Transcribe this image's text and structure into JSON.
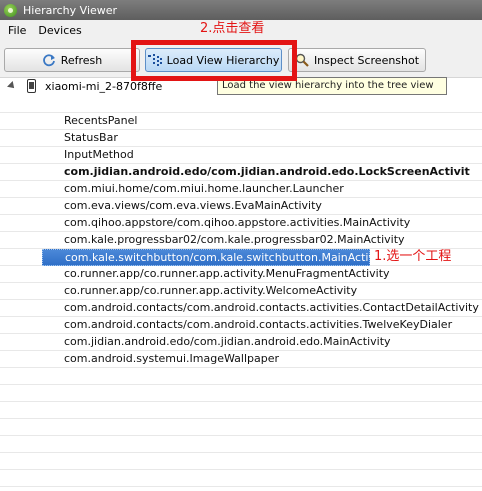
{
  "window": {
    "title": "Hierarchy Viewer"
  },
  "menu": {
    "items": [
      "File",
      "Devices"
    ]
  },
  "toolbar": {
    "refresh_label": "Refresh",
    "load_label": "Load View Hierarchy",
    "inspect_label": "Inspect Screenshot"
  },
  "tooltip": {
    "text": "Load the view hierarchy into the tree view"
  },
  "annotations": {
    "step2": "2.点击查看",
    "step1": "1.选一个工程",
    "color": "#e31414"
  },
  "device": {
    "name": "xiaomi-mi_2-870f8ffe"
  },
  "windows": [
    {
      "label": "RecentsPanel",
      "bold": false,
      "selected": false
    },
    {
      "label": "StatusBar",
      "bold": false,
      "selected": false
    },
    {
      "label": "InputMethod",
      "bold": false,
      "selected": false
    },
    {
      "label": "com.jidian.android.edo/com.jidian.android.edo.LockScreenActivit",
      "bold": true,
      "selected": false
    },
    {
      "label": "com.miui.home/com.miui.home.launcher.Launcher",
      "bold": false,
      "selected": false
    },
    {
      "label": "com.eva.views/com.eva.views.EvaMainActivity",
      "bold": false,
      "selected": false
    },
    {
      "label": "com.qihoo.appstore/com.qihoo.appstore.activities.MainActivity",
      "bold": false,
      "selected": false
    },
    {
      "label": "com.kale.progressbar02/com.kale.progressbar02.MainActivity",
      "bold": false,
      "selected": false
    },
    {
      "label": "com.kale.switchbutton/com.kale.switchbutton.MainActivity",
      "bold": false,
      "selected": true
    },
    {
      "label": "co.runner.app/co.runner.app.activity.MenuFragmentActivity",
      "bold": false,
      "selected": false
    },
    {
      "label": "co.runner.app/co.runner.app.activity.WelcomeActivity",
      "bold": false,
      "selected": false
    },
    {
      "label": "com.android.contacts/com.android.contacts.activities.ContactDetailActivity",
      "bold": false,
      "selected": false
    },
    {
      "label": "com.android.contacts/com.android.contacts.activities.TwelveKeyDialer",
      "bold": false,
      "selected": false
    },
    {
      "label": "com.jidian.android.edo/com.jidian.android.edo.MainActivity",
      "bold": false,
      "selected": false
    },
    {
      "label": "com.android.systemui.ImageWallpaper",
      "bold": false,
      "selected": false
    }
  ],
  "icons": {
    "app": "hierarchy-viewer-icon",
    "refresh": "refresh-icon",
    "load": "load-hierarchy-icon",
    "inspect": "magnifier-icon",
    "device": "phone-icon"
  }
}
